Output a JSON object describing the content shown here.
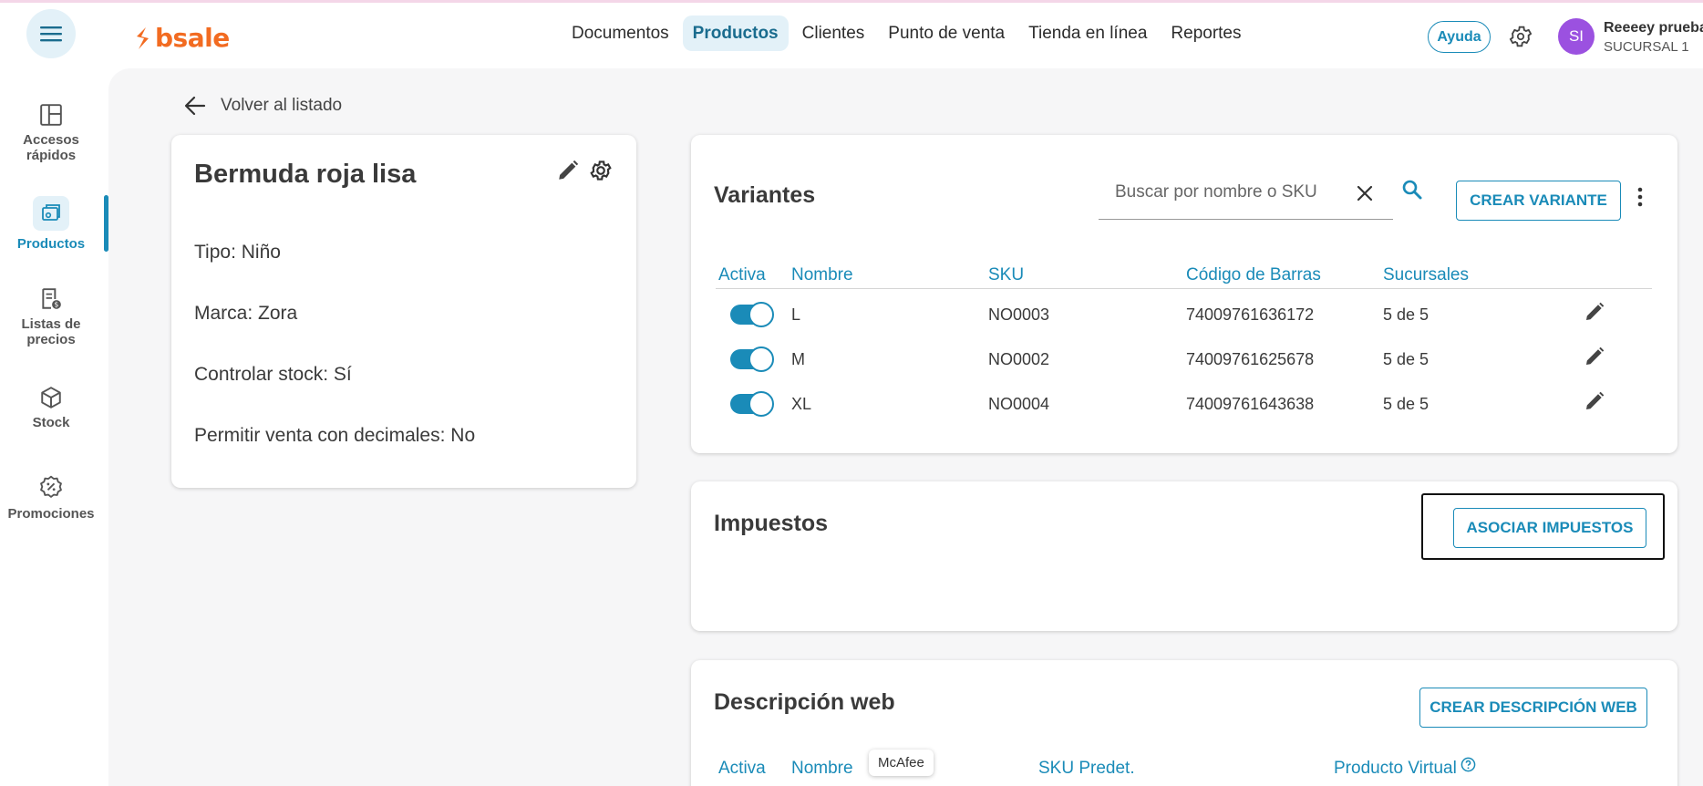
{
  "header": {
    "logo_text": "bsale",
    "nav": [
      {
        "label": "Documentos"
      },
      {
        "label": "Productos"
      },
      {
        "label": "Clientes"
      },
      {
        "label": "Punto de venta"
      },
      {
        "label": "Tienda en línea"
      },
      {
        "label": "Reportes"
      }
    ],
    "active_nav": "Productos",
    "help_label": "Ayuda",
    "user": {
      "initials": "SI",
      "name": "Reeeey prueba",
      "branch": "SUCURSAL 1"
    }
  },
  "sidebar": {
    "items": [
      {
        "label_1": "Accesos",
        "label_2": "rápidos",
        "icon": "layout-icon"
      },
      {
        "label_1": "Productos",
        "label_2": "",
        "icon": "products-icon"
      },
      {
        "label_1": "Listas de",
        "label_2": "precios",
        "icon": "price-list-icon"
      },
      {
        "label_1": "Stock",
        "label_2": "",
        "icon": "cube-icon"
      },
      {
        "label_1": "Promociones",
        "label_2": "",
        "icon": "percent-badge-icon"
      }
    ],
    "active": "Productos"
  },
  "back_label": "Volver al listado",
  "product": {
    "name": "Bermuda roja lisa",
    "fields": [
      "Tipo: Niño",
      "Marca: Zora",
      "Controlar stock: Sí",
      "Permitir venta con decimales: No"
    ]
  },
  "variants": {
    "title": "Variantes",
    "search_placeholder": "Buscar por nombre o SKU",
    "search_value": "",
    "create_label": "CREAR VARIANTE",
    "columns": [
      "Activa",
      "Nombre",
      "SKU",
      "Código de Barras",
      "Sucursales"
    ],
    "rows": [
      {
        "active": true,
        "name": "L",
        "sku": "NO0003",
        "barcode": "74009761636172",
        "branches": "5 de 5"
      },
      {
        "active": true,
        "name": "M",
        "sku": "NO0002",
        "barcode": "74009761625678",
        "branches": "5 de 5"
      },
      {
        "active": true,
        "name": "XL",
        "sku": "NO0004",
        "barcode": "74009761643638",
        "branches": "5 de 5"
      }
    ]
  },
  "taxes": {
    "title": "Impuestos",
    "associate_label": "ASOCIAR IMPUESTOS"
  },
  "web_description": {
    "title": "Descripción web",
    "create_label": "CREAR DESCRIPCIÓN WEB",
    "columns": [
      "Activa",
      "Nombre",
      "SKU Predet.",
      "Producto Virtual"
    ]
  },
  "tooltip": "McAfee",
  "colors": {
    "accent": "#1a8bb8",
    "brand": "#f26b21",
    "avatar": "#9b51e0"
  }
}
